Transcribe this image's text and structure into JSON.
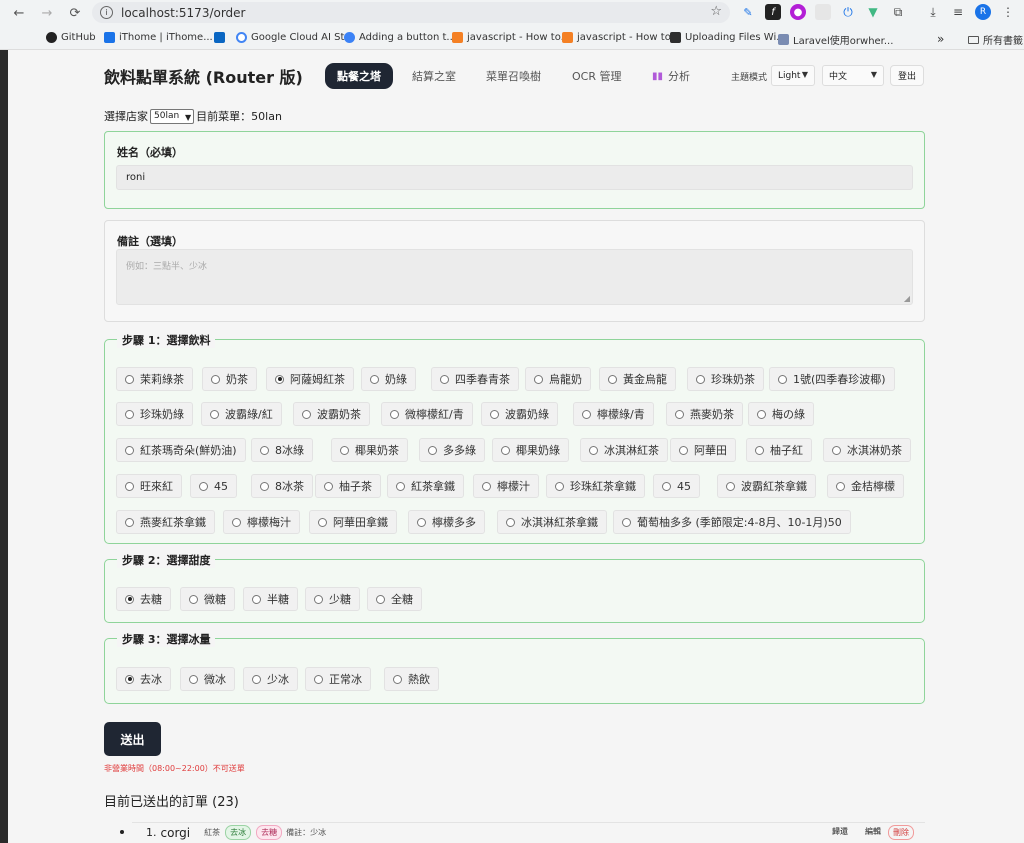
{
  "browser": {
    "url": "localhost:5173/order",
    "bookmarks": [
      {
        "label": "GitHub",
        "color": "#222222"
      },
      {
        "label": "iThome | iThome...",
        "color": "#1a73e8"
      },
      {
        "label": "",
        "color": "#0a66c2"
      },
      {
        "label": "Google Cloud AI St...",
        "color": "#4285f4"
      },
      {
        "label": "Adding a button t...",
        "color": "#3b82f6"
      },
      {
        "label": "javascript - How to...",
        "color": "#f48024"
      },
      {
        "label": "javascript - How to...",
        "color": "#f48024"
      },
      {
        "label": "Uploading Files Wi...",
        "color": "#2e2e2e"
      },
      {
        "label": "Laravel使用orwher...",
        "color": "#7a8cb2"
      }
    ],
    "bookmarks_more": "»",
    "all_bookmarks": "所有書籤",
    "profile_initial": "R"
  },
  "header": {
    "title": "飲料點單系統 (Router 版)",
    "tabs": [
      {
        "label": "點餐之塔",
        "active": true
      },
      {
        "label": "結算之室",
        "active": false
      },
      {
        "label": "菜單召喚樹",
        "active": false
      },
      {
        "label": "OCR 管理",
        "active": false
      },
      {
        "label": "分析",
        "active": false
      }
    ],
    "theme_label": "主題模式",
    "theme_value": "Light",
    "language_value": "中文",
    "logout_label": "登出"
  },
  "store": {
    "label": "選擇店家",
    "value": "50lan",
    "current_menu": "目前菜單：50lan"
  },
  "name_field": {
    "label": "姓名（必填）",
    "value": "roni"
  },
  "note_field": {
    "label": "備註（選填）",
    "placeholder": "例如：三點半、少冰"
  },
  "step1": {
    "legend": "步驟 1：選擇飲料",
    "options": [
      "茉莉綠茶",
      "奶茶",
      "阿薩姆紅茶",
      "奶綠",
      "四季春青茶",
      "烏龍奶",
      "黃金烏龍",
      "珍珠奶茶",
      "1號(四季春珍波椰)",
      "珍珠奶綠",
      "波霸綠/紅",
      "波霸奶茶",
      "微檸檬紅/青",
      "波霸奶綠",
      "檸檬綠/青",
      "燕麥奶茶",
      "梅の綠",
      "紅茶瑪奇朵(鮮奶油)",
      "8冰綠",
      "椰果奶茶",
      "多多綠",
      "椰果奶綠",
      "冰淇淋紅茶",
      "阿華田",
      "柚子紅",
      "冰淇淋奶茶",
      "旺來紅",
      "45",
      "8冰茶",
      "柚子茶",
      "紅茶拿鐵",
      "檸檬汁",
      "珍珠紅茶拿鐵",
      "45",
      "波霸紅茶拿鐵",
      "金桔檸檬",
      "燕麥紅茶拿鐵",
      "檸檬梅汁",
      "阿華田拿鐵",
      "檸檬多多",
      "冰淇淋紅茶拿鐵",
      "葡萄柚多多 (季節限定:4-8月、10-1月)50"
    ],
    "selected": 2
  },
  "step2": {
    "legend": "步驟 2：選擇甜度",
    "options": [
      "去糖",
      "微糖",
      "半糖",
      "少糖",
      "全糖"
    ],
    "selected": 0
  },
  "step3": {
    "legend": "步驟 3：選擇冰量",
    "options": [
      "去冰",
      "微冰",
      "少冰",
      "正常冰",
      "熱飲"
    ],
    "selected": 0
  },
  "submit_label": "送出",
  "warning": "非營業時間（08:00~22:00）不可送單",
  "orders": {
    "title": "目前已送出的訂單 (23)",
    "items": [
      {
        "index": "1.",
        "name": "corgi",
        "drink": "紅茶",
        "ice": "去冰",
        "sugar": "去糖",
        "note": "備註：少冰",
        "actions": [
          "歸還",
          "編輯",
          "刪除"
        ]
      }
    ]
  },
  "colors": {
    "accent_dark": "#1f2633",
    "success_border": "#8fd49a",
    "warning_red": "#e03c3c"
  }
}
